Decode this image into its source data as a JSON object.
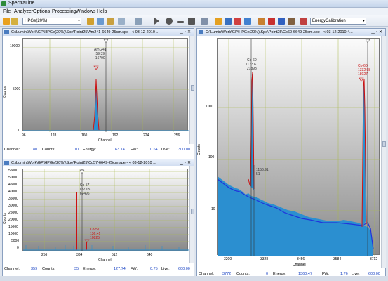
{
  "window": {
    "title": "SpectraLine"
  },
  "menu": [
    "File",
    "Analyzer",
    "Options",
    "Processing",
    "Windows",
    "Help"
  ],
  "toolbar": {
    "detector": "HPGe(20%)",
    "calibration": "EnergyCalibration"
  },
  "colors": {
    "spectrum": "#2b8fd0",
    "peak": "#cc1111",
    "baseline": "#1f33dd",
    "grid": "#a8b84a",
    "statusValue": "#1a44c4"
  },
  "panels": {
    "topleft": {
      "title": "C:\\Lumin\\Work\\GP\\HPGe(20%)\\Spe\\Point25\\Am241-6649-25cm.spe - < 03-12-2010 ...",
      "yticks": [
        "10000",
        "5000",
        "0"
      ],
      "xticks": [
        "96",
        "128",
        "160",
        "192",
        "224",
        "256"
      ],
      "xlabel": "Channel",
      "ylabel": "Counts",
      "peak": {
        "name": "Am-241",
        "energy": "59.39",
        "counts": "16790"
      },
      "status": {
        "channel_label": "Channel:",
        "channel": "180",
        "counts_label": "Counts:",
        "counts": "10",
        "energy_label": "Energy:",
        "energy": "63.14",
        "fw_label": "FW:",
        "fw": "0.64",
        "live_label": "Live:",
        "live": "300.00"
      }
    },
    "bottomleft": {
      "title": "C:\\Lumin\\Work\\GP\\HPGe(20%)\\Spe\\Point25\\Co57-6649-25cm.spe - < 03-12-2010 ...",
      "yticks": [
        "55000",
        "50000",
        "45000",
        "40000",
        "35000",
        "30000",
        "25000",
        "20000",
        "15000",
        "10000",
        "5000",
        "0"
      ],
      "xticks": [
        "256",
        "384",
        "512",
        "640"
      ],
      "xlabel": "Channel",
      "ylabel": "Counts",
      "peak1": {
        "name": "Co-57",
        "energy": "122.05",
        "counts": "67496"
      },
      "peak2": {
        "name": "Co-57",
        "energy": "136.41",
        "counts": "10825"
      },
      "status": {
        "channel_label": "Channel:",
        "channel": "359",
        "counts_label": "Counts:",
        "counts": "35",
        "energy_label": "Energy:",
        "energy": "127.74",
        "fw_label": "FW:",
        "fw": "0.75",
        "live_label": "Live:",
        "live": "600.00"
      }
    },
    "right": {
      "title": "C:\\Lumin\\Work\\GP\\HPGe(20%)\\Spe\\Point25\\Co60-6649-25cm.spe - < 03-12-2010 4...",
      "yticks": [
        "1000",
        "100",
        "10"
      ],
      "xticks": [
        "3200",
        "3328",
        "3456",
        "3584",
        "3712"
      ],
      "xlabel": "Channel",
      "ylabel": "Counts",
      "peak1": {
        "name": "Co-60",
        "energy": "1173.67",
        "counts": "21893"
      },
      "peak2": {
        "name": "Co-60",
        "energy": "1332.98",
        "counts": "18027"
      },
      "marker": {
        "energy": "1156.91",
        "counts": "51"
      },
      "status": {
        "channel_label": "Channel:",
        "channel": "3772",
        "counts_label": "Counts:",
        "counts": "0",
        "energy_label": "Energy:",
        "energy": "1360.47",
        "fw_label": "FW:",
        "fw": "1.76",
        "live_label": "Live:",
        "live": "600.00"
      }
    }
  }
}
